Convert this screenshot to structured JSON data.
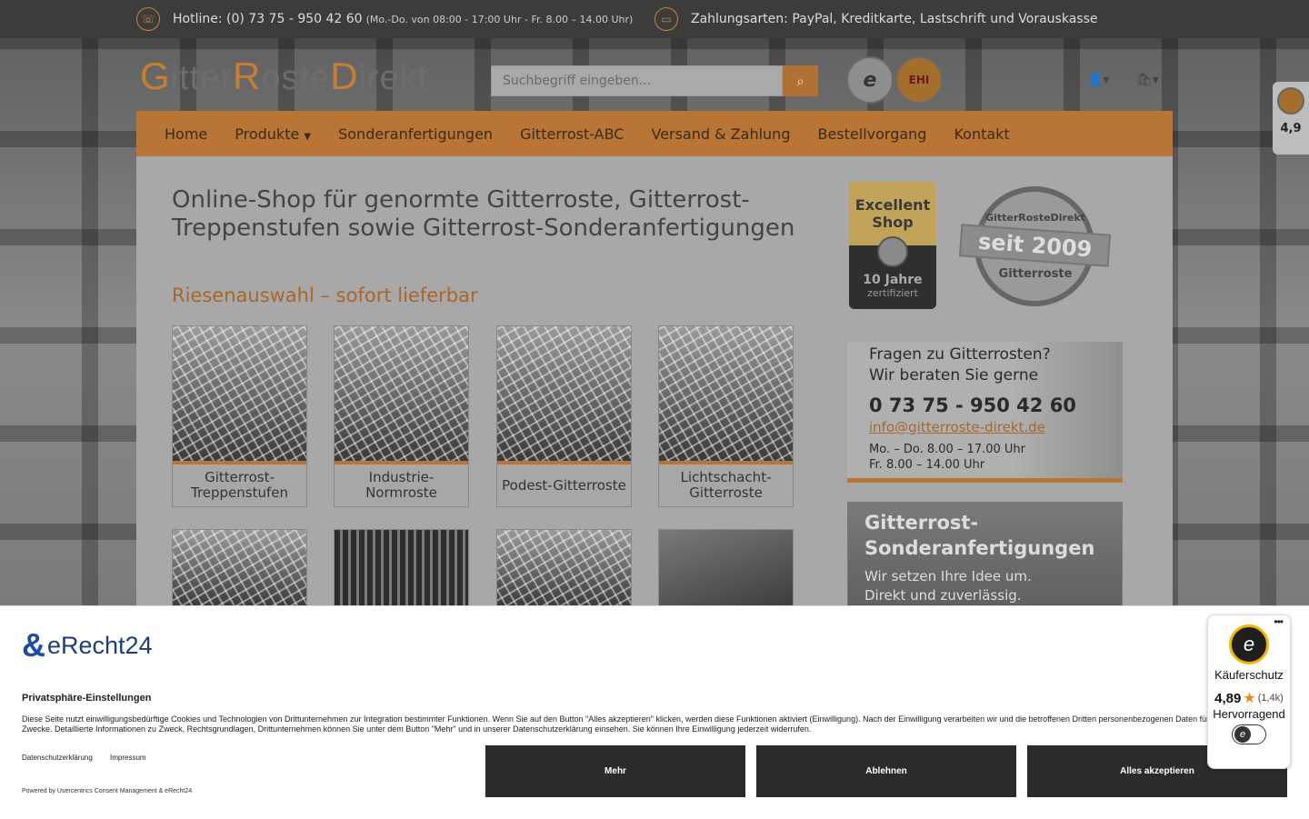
{
  "topbar": {
    "hotline": "Hotline: (0) 73 75 - 950 42 60",
    "hours": "(Mo.-Do. von 08:00 - 17:00 Uhr - Fr. 8.00 – 14.00 Uhr)",
    "payment": "Zahlungsarten: PayPal, Kreditkarte, Lastschrift und Vorauskasse"
  },
  "header": {
    "logo": {
      "p1cap": "G",
      "p1": "itter",
      "p2cap": "R",
      "p2": "oste",
      "p3cap": "D",
      "p3": "irekt"
    },
    "search_placeholder": "Suchbegriff eingeben...",
    "badge_ts": "e",
    "badge_ehi": "EHI"
  },
  "nav": [
    "Home",
    "Produkte",
    "Sonderanfertigungen",
    "Gitterrost-ABC",
    "Versand & Zahlung",
    "Bestellvorgang",
    "Kontakt"
  ],
  "main": {
    "headline": "Online-Shop für genormte Gitterroste, Gitterrost-Treppenstufen sowie Gitterrost-Sonderanfertigungen",
    "subline": "Riesenauswahl – sofort lieferbar",
    "tiles": [
      {
        "label": "Gitterrost-Treppenstufen"
      },
      {
        "label": "Industrie-Normroste"
      },
      {
        "label": "Podest-Gitterroste"
      },
      {
        "label": "Lichtschacht-Gitterroste"
      }
    ]
  },
  "aside": {
    "excellent": {
      "l1": "Excellent",
      "l2": "Shop",
      "l3": "10 Jahre",
      "l4": "zertifiziert"
    },
    "seal": {
      "top": "GitterRosteDirekt",
      "mid": "seit 2009",
      "bottom": "Gitterroste"
    },
    "contact": {
      "q1": "Fragen zu Gitterrosten?",
      "q2": "Wir beraten Sie gerne",
      "phone": "0 73 75 - 950 42 60",
      "email": "info@gitterroste-direkt.de",
      "h1": "Mo. – Do.  8.00 – 17.00 Uhr",
      "h2": "Fr.  8.00 – 14.00 Uhr"
    },
    "special": {
      "t1": "Gitterrost-",
      "t2": "Sonderanfertigungen",
      "s1": "Wir setzen Ihre Idee um.",
      "s2": "Direkt und zuverlässig."
    }
  },
  "side_widget": {
    "rating": "4,9"
  },
  "consent": {
    "brand": "eRecht24",
    "title": "Privatsphäre-Einstellungen",
    "text": "Diese Seite nutzt einwilligungsbedürftige Cookies und Technologien von Drittunternehmen zur Integration bestimmter Funktionen. Wenn Sie auf den Button \"Alles akzeptieren\" klicken, werden diese Funktionen aktiviert (Einwilligung). Nach der Einwilligung verarbeiten wir und die betroffenen Dritten personenbezogenen Daten für verschiedene Zwecke. Detaillierte Informationen zu Zweck, Rechtsgrundlagen, Drittunternehmen können Sie unter dem Button \"Mehr\" und in unserer Datenschutzerklärung einsehen. Sie können Ihre Einwilligung jederzeit widerrufen.",
    "link_privacy": "Datenschutzerklärung",
    "link_imprint": "Impressum",
    "powered": "Powered by Usercentrics Consent Management & eRecht24",
    "btn_more": "Mehr",
    "btn_decline": "Ablehnen",
    "btn_accept": "Alles akzeptieren"
  },
  "trusted": {
    "label": "Käuferschutz",
    "score": "4,89",
    "count": "(1,4k)",
    "verdict": "Hervorragend"
  }
}
